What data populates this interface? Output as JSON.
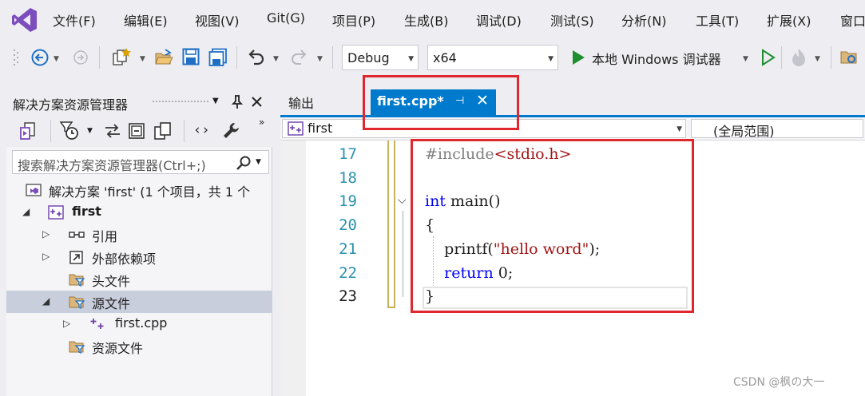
{
  "menubar": {
    "items": [
      "文件(F)",
      "编辑(E)",
      "视图(V)",
      "Git(G)",
      "项目(P)",
      "生成(B)",
      "调试(D)",
      "测试(S)",
      "分析(N)",
      "工具(T)",
      "扩展(X)",
      "窗口"
    ]
  },
  "toolbar": {
    "configuration": "Debug",
    "platform": "x64",
    "run_label": "本地 Windows 调试器"
  },
  "solution_explorer": {
    "title": "解决方案资源管理器",
    "search_placeholder": "搜索解决方案资源管理器(Ctrl+;)",
    "tree": [
      {
        "label": "解决方案 'first' (1 个项目，共 1 个",
        "expander": "",
        "icon": "solution-icon",
        "bold": false,
        "selected": false
      },
      {
        "label": "first",
        "expander": "◢",
        "icon": "cpp-project-icon",
        "bold": true,
        "selected": false
      },
      {
        "label": "引用",
        "expander": "▷",
        "icon": "references-icon",
        "bold": false,
        "selected": false
      },
      {
        "label": "外部依赖项",
        "expander": "▷",
        "icon": "external-dependencies-icon",
        "bold": false,
        "selected": false
      },
      {
        "label": "头文件",
        "expander": "",
        "icon": "filter-folder-icon",
        "bold": false,
        "selected": false
      },
      {
        "label": "源文件",
        "expander": "◢",
        "icon": "filter-folder-icon",
        "bold": false,
        "selected": true
      },
      {
        "label": "first.cpp",
        "expander": "▷",
        "icon": "cpp-file-icon",
        "bold": false,
        "selected": false
      },
      {
        "label": "资源文件",
        "expander": "",
        "icon": "filter-folder-icon",
        "bold": false,
        "selected": false
      }
    ]
  },
  "tabs": {
    "output_label": "输出",
    "active_label": "first.cpp*"
  },
  "navbar": {
    "project": "first",
    "scope": "(全局范围)"
  },
  "editor": {
    "line_numbers": [
      "17",
      "18",
      "19",
      "20",
      "21",
      "22",
      "23"
    ],
    "current_line": "23",
    "lines": [
      [
        {
          "t": "#include",
          "c": "pp"
        },
        {
          "t": "<stdio.h>",
          "c": "str"
        }
      ],
      [],
      [
        {
          "t": "int",
          "c": "kw"
        },
        {
          "t": " main()",
          "c": ""
        }
      ],
      [
        {
          "t": "{",
          "c": ""
        }
      ],
      [
        {
          "t": "    printf(",
          "c": ""
        },
        {
          "t": "\"hello word\"",
          "c": "str"
        },
        {
          "t": ");",
          "c": ""
        }
      ],
      [
        {
          "t": "    ",
          "c": ""
        },
        {
          "t": "return",
          "c": "kw"
        },
        {
          "t": " 0;",
          "c": ""
        }
      ],
      [
        {
          "t": "}",
          "c": ""
        }
      ]
    ]
  },
  "colors": {
    "accent": "#007acc",
    "highlight_box": "#e0262e",
    "keyword": "#0000ff",
    "string": "#a31515",
    "line_number": "#2b91af"
  },
  "watermark": "CSDN @枫の大一"
}
